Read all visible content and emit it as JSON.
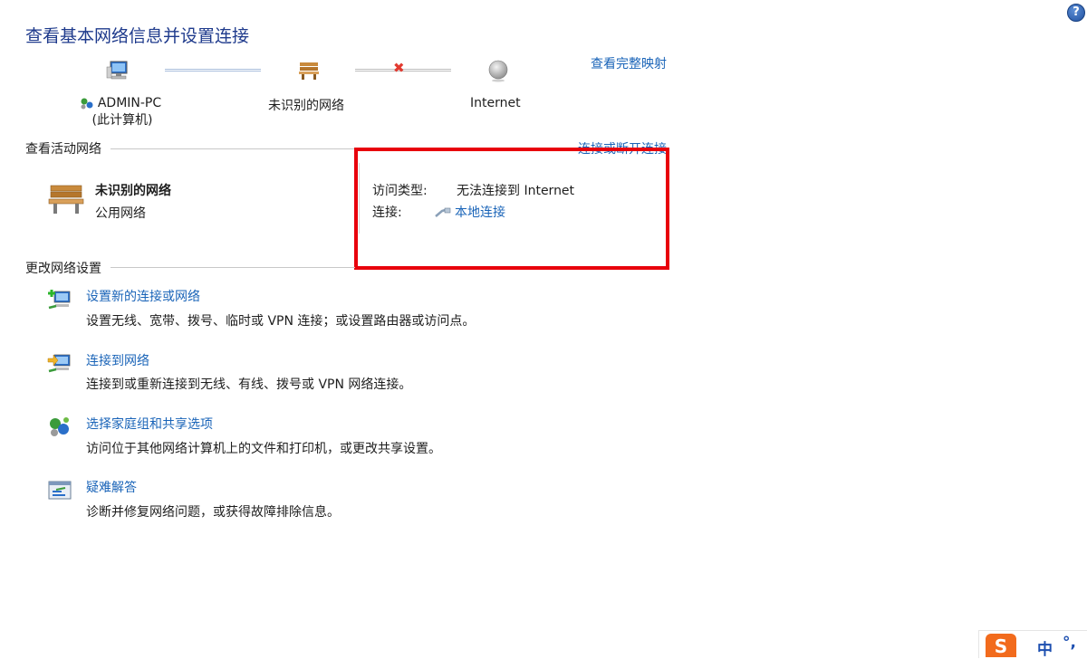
{
  "header": {
    "title": "查看基本网络信息并设置连接",
    "view_full_map": "查看完整映射",
    "help": "?"
  },
  "network_map": {
    "computer_name": "ADMIN-PC",
    "computer_sub": "(此计算机)",
    "network_name": "未识别的网络",
    "internet_label": "Internet",
    "status_icon": "x-icon"
  },
  "active_networks": {
    "section_title": "查看活动网络",
    "connect_disconnect": "连接或断开连接",
    "network": {
      "name": "未识别的网络",
      "category": "公用网络"
    },
    "access_type_label": "访问类型:",
    "access_type_value": "无法连接到 Internet",
    "connections_label": "连接:",
    "connections_value": "本地连接"
  },
  "change_settings": {
    "section_title": "更改网络设置",
    "tasks": [
      {
        "title": "设置新的连接或网络",
        "desc": "设置无线、宽带、拨号、临时或 VPN 连接；或设置路由器或访问点。",
        "icon": "new-connection-icon"
      },
      {
        "title": "连接到网络",
        "desc": "连接到或重新连接到无线、有线、拨号或 VPN 网络连接。",
        "icon": "connect-network-icon"
      },
      {
        "title": "选择家庭组和共享选项",
        "desc": "访问位于其他网络计算机上的文件和打印机，或更改共享设置。",
        "icon": "homegroup-icon"
      },
      {
        "title": "疑难解答",
        "desc": "诊断并修复网络问题，或获得故障排除信息。",
        "icon": "troubleshoot-icon"
      }
    ]
  },
  "ime": {
    "logo": "S",
    "mode": "中",
    "punct": "°,"
  },
  "colors": {
    "link": "#1a64b8",
    "title": "#1e3a8c",
    "highlight_box": "#e8000c"
  }
}
